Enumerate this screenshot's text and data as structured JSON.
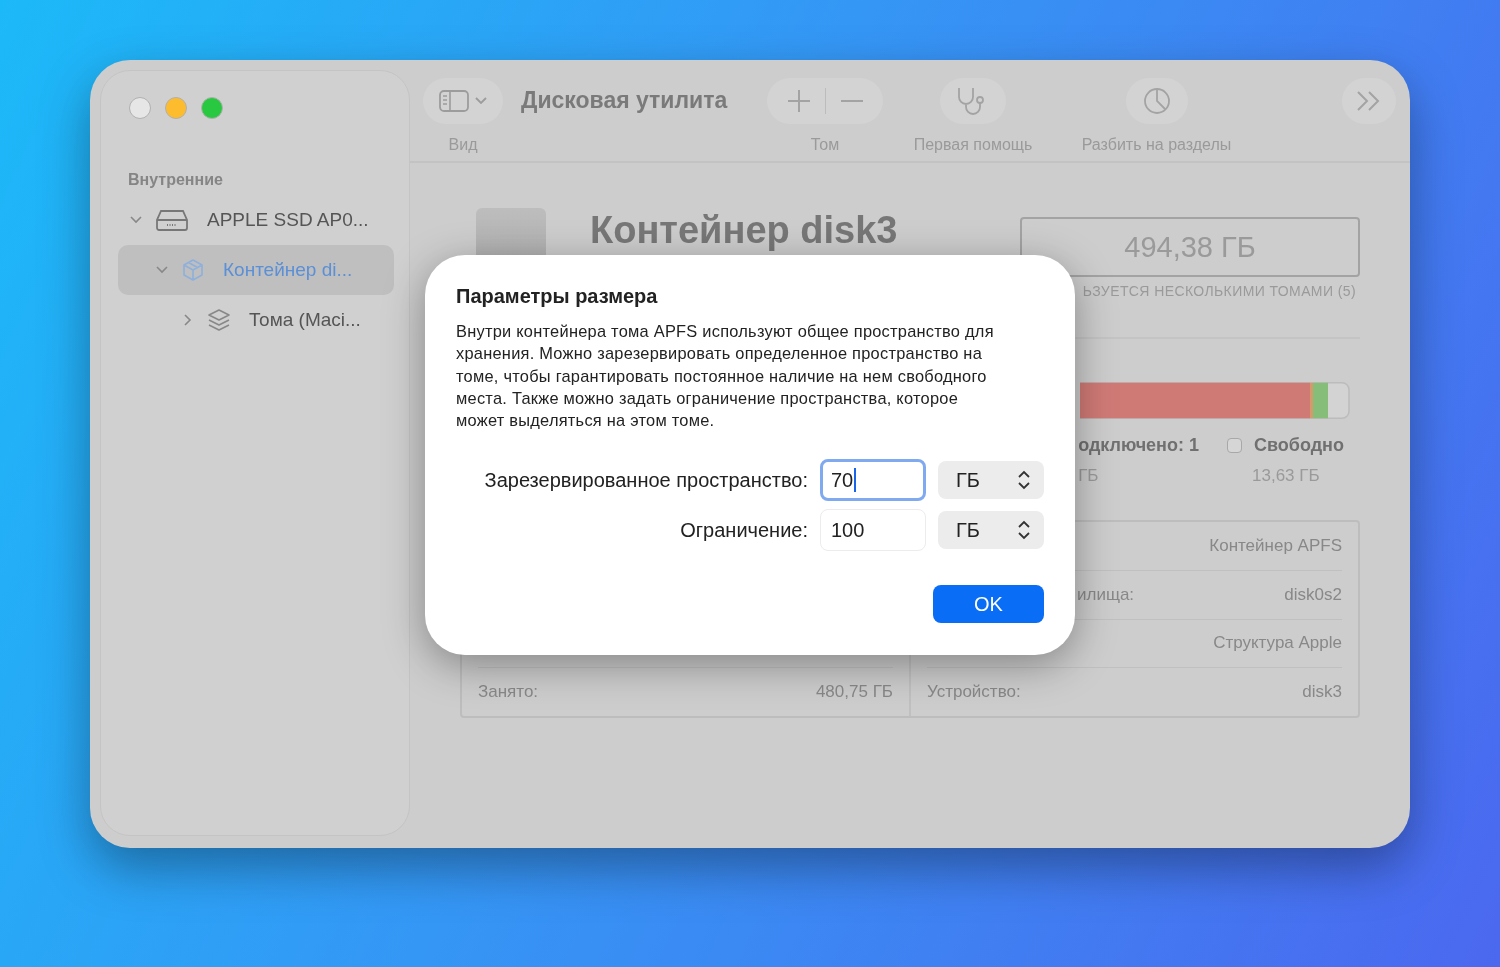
{
  "window": {
    "traffic_lights": [
      {
        "kind": "close"
      },
      {
        "kind": "minimize"
      },
      {
        "kind": "zoom"
      }
    ]
  },
  "toolbar": {
    "title": "Дисковая утилита",
    "items": [
      {
        "kind": "view",
        "label": "Вид"
      },
      {
        "kind": "volume",
        "label": "Том"
      },
      {
        "kind": "first-aid",
        "label": "Первая помощь"
      },
      {
        "kind": "partition",
        "label": "Разбить на разделы"
      }
    ]
  },
  "sidebar": {
    "heading": "Внутренние",
    "items": [
      {
        "kind": "drive",
        "label": "APPLE SSD AP0...",
        "selected": false,
        "expanded": true,
        "children": [
          {
            "kind": "container",
            "label": "Контейнер di...",
            "selected": true,
            "expanded": true,
            "children": [
              {
                "kind": "volumes",
                "label": "Тома (Maci...",
                "selected": false,
                "expanded": false
              }
            ]
          }
        ]
      }
    ]
  },
  "header": {
    "title": "Контейнер disk3",
    "capacity": "494,38 ГБ",
    "caption": "ЬЗУЕТСЯ НЕСКОЛЬКИМИ ТОМАМИ (5)"
  },
  "legend": [
    {
      "label": "одключено: 1",
      "value": "ГБ",
      "swatch": false
    },
    {
      "label": "Свободно",
      "value": "13,63 ГБ",
      "swatch": true
    }
  ],
  "info": {
    "left": [
      {
        "label": "Занято:",
        "value": "480,75 ГБ"
      }
    ],
    "right": [
      {
        "value": "Контейнер APFS"
      },
      {
        "label": "илища:",
        "value": "disk0s2"
      },
      {
        "value": "Структура Apple"
      },
      {
        "label": "Устройство:",
        "value": "disk3"
      }
    ]
  },
  "dialog": {
    "title": "Параметры размера",
    "text": "Внутри контейнера тома APFS используют общее пространство для хранения. Можно зарезервировать определенное пространство на томе, чтобы гарантировать постоянное наличие на нем свободного места. Также можно задать ограничение пространства, которое может выделяться на этом томе.",
    "fields": [
      {
        "label": "Зарезервированное пространство:",
        "value": "70",
        "unit": "ГБ",
        "focused": true
      },
      {
        "label": "Ограничение:",
        "value": "100",
        "unit": "ГБ",
        "focused": false
      }
    ],
    "ok": "OK"
  }
}
